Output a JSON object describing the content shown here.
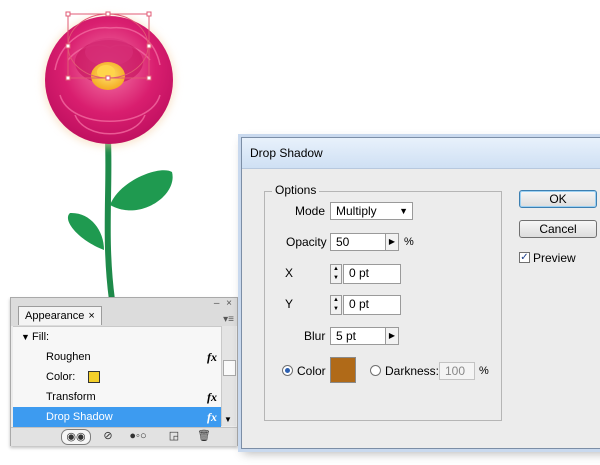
{
  "colors": {
    "petal": "#d41d6d",
    "petal_light": "#f04a8a",
    "center": "#ffc21a",
    "stem": "#1e8a4a",
    "shadow_swatch": "#b06a18",
    "selection": "#3d9bf0",
    "fill_swatch": "#f3cf2a"
  },
  "appearance": {
    "tab_label": "Appearance",
    "tab_close": "×",
    "top_controls": "– ×",
    "menu_glyph": "▾≡",
    "fill_label": "Fill:",
    "rows": [
      {
        "label": "Roughen",
        "fx": "fx"
      },
      {
        "label": "Color:",
        "fx": ""
      },
      {
        "label": "Transform",
        "fx": "fx"
      },
      {
        "label": "Drop Shadow",
        "fx": "fx"
      }
    ]
  },
  "dialog": {
    "title": "Drop Shadow",
    "options_label": "Options",
    "mode_label": "Mode",
    "mode_value": "Multiply",
    "opacity_label": "Opacity",
    "opacity_value": "50",
    "opacity_unit": "%",
    "x_label": "X",
    "x_value": "0 pt",
    "y_label": "Y",
    "y_value": "0 pt",
    "blur_label": "Blur",
    "blur_value": "5 pt",
    "color_label": "Color",
    "darkness_label": "Darkness:",
    "darkness_value": "100",
    "darkness_unit": "%",
    "ok_label": "OK",
    "cancel_label": "Cancel",
    "preview_label": "Preview",
    "preview_checked": true
  }
}
